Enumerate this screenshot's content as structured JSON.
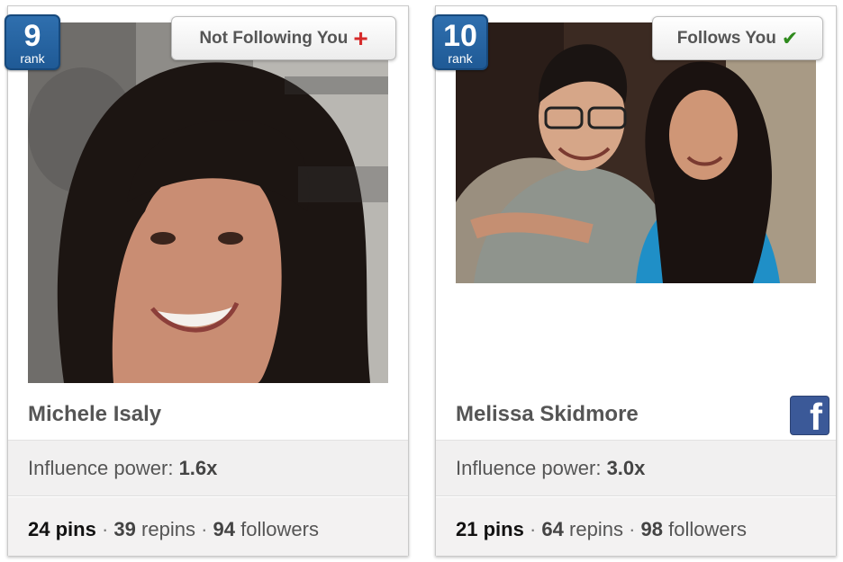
{
  "cards": [
    {
      "rank": "9",
      "rank_label": "rank",
      "follow_status": "Not Following You",
      "follow_icon": "plus-icon",
      "name": "Michele Isaly",
      "influence_label": "Influence power:",
      "influence_value": "1.6x",
      "pins_count": "24",
      "pins_label": "pins",
      "repins_count": "39",
      "repins_label": "repins",
      "followers_count": "94",
      "followers_label": "followers",
      "has_facebook": false
    },
    {
      "rank": "10",
      "rank_label": "rank",
      "follow_status": "Follows You",
      "follow_icon": "checkmark-icon",
      "name": "Melissa Skidmore",
      "influence_label": "Influence power:",
      "influence_value": "3.0x",
      "pins_count": "21",
      "pins_label": "pins",
      "repins_count": "64",
      "repins_label": "repins",
      "followers_count": "98",
      "followers_label": "followers",
      "has_facebook": true
    }
  ],
  "icons": {
    "plus_glyph": "+",
    "check_glyph": "✔",
    "facebook_glyph": "f",
    "separator": "·"
  },
  "colors": {
    "rank_badge": "#2a66a6",
    "plus": "#d62b2b",
    "check": "#2f8a1d",
    "facebook": "#3b5998",
    "text": "#555555"
  }
}
